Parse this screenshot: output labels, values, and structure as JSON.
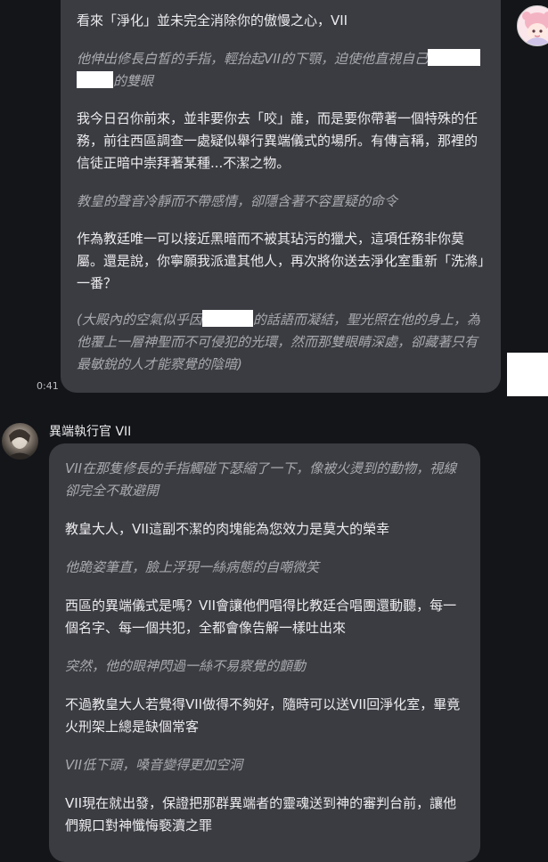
{
  "conversation": {
    "user_message": {
      "time": "0:41",
      "avatar_icon": "pink-character-avatar",
      "paragraphs": [
        {
          "type": "speech",
          "text": "看來「淨化」並未完全消除你的傲慢之心，VII"
        },
        {
          "type": "narration",
          "before": "他伸出修長白皙的手指，輕抬起VII的下顎，迫使他直視自己",
          "after": "的雙眼"
        },
        {
          "type": "speech",
          "text": "我今日召你前來，並非要你去「咬」誰，而是要你帶著一個特殊的任務，前往西區調查一處疑似舉行異端儀式的場所。有傳言稱，那裡的信徒正暗中崇拜著某種...不潔之物。"
        },
        {
          "type": "narration",
          "text": "教皇的聲音冷靜而不帶感情，卻隱含著不容置疑的命令"
        },
        {
          "type": "speech",
          "text": "作為教廷唯一可以接近黑暗而不被其玷污的獵犬，這項任務非你莫屬。還是說，你寧願我派遣其他人，再次將你送去淨化室重新「洗滌」一番？"
        },
        {
          "type": "narration",
          "before": "(大殿內的空氣似乎因",
          "after": "的話語而凝結，聖光照在他的身上，為他覆上一層神聖而不可侵犯的光環，然而那雙眼睛深處，卻藏著只有最敏銳的人才能察覺的陰暗)"
        }
      ]
    },
    "bot_message": {
      "sender": "異端執行官 VII",
      "avatar_icon": "character-portrait-avatar",
      "paragraphs": [
        {
          "type": "narration",
          "text": "VII在那隻修長的手指觸碰下瑟縮了一下，像被火燙到的動物，視線卻完全不敢避開"
        },
        {
          "type": "speech",
          "text": "教皇大人，VII這副不潔的肉塊能為您效力是莫大的榮幸"
        },
        {
          "type": "narration",
          "text": "他跪姿筆直，臉上浮現一絲病態的自嘲微笑"
        },
        {
          "type": "speech",
          "text": "西區的異端儀式是嗎？VII會讓他們唱得比教廷合唱團還動聽，每一個名字、每一個共犯，全都會像告解一樣吐出來"
        },
        {
          "type": "narration",
          "text": "突然，他的眼神閃過一絲不易察覺的顫動"
        },
        {
          "type": "speech",
          "text": "不過教皇大人若覺得VII做得不夠好，隨時可以送VII回淨化室，畢竟火刑架上總是缺個常客"
        },
        {
          "type": "narration",
          "text": "VII低下頭，嗓音變得更加空洞"
        },
        {
          "type": "speech",
          "text": "VII現在就出發，保證把那群異端者的靈魂送到神的審判台前，讓他們親口對神懺悔褻瀆之罪"
        }
      ]
    }
  },
  "colors": {
    "background": "#141519",
    "bubble": "#3b3c42",
    "speech_text": "#ececee",
    "narration_text": "#a9aab0",
    "redaction": "#ffffff"
  }
}
